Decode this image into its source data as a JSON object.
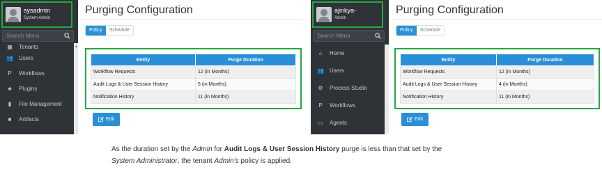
{
  "colors": {
    "accent": "#2a8fd6",
    "highlight_border": "#28a745",
    "sidebar_bg": "#2f3237"
  },
  "left": {
    "user": {
      "name": "sysadmin",
      "role": "System Admin"
    },
    "search_placeholder": "Search Menu",
    "menu": [
      {
        "label": "Tenants",
        "icon": "building-icon"
      },
      {
        "label": "Users",
        "icon": "users-icon"
      },
      {
        "label": "Workflows",
        "icon": "workflow-icon"
      },
      {
        "label": "Plugins",
        "icon": "plugin-icon"
      },
      {
        "label": "File Management",
        "icon": "file-icon"
      },
      {
        "label": "Artifacts",
        "icon": "artifact-icon"
      }
    ],
    "title": "Purging Configuration",
    "tabs": [
      "Policy",
      "Schedule"
    ],
    "table": {
      "headers": [
        "Entity",
        "Purge Duration"
      ],
      "rows": [
        [
          "Workflow Requests",
          "12 (in Months)"
        ],
        [
          "Audit Logs & User Session History",
          "5 (in Months)"
        ],
        [
          "Notification History",
          "11 (in Months)"
        ]
      ]
    },
    "edit_label": "Edit"
  },
  "right": {
    "user": {
      "name": "ajinkya-",
      "role": "Admin"
    },
    "search_placeholder": "Search Menu",
    "menu": [
      {
        "label": "Home",
        "icon": "home-icon"
      },
      {
        "label": "Users",
        "icon": "users-icon"
      },
      {
        "label": "Process Studio",
        "icon": "gears-icon"
      },
      {
        "label": "Workflows",
        "icon": "workflow-icon"
      },
      {
        "label": "Agents",
        "icon": "monitor-icon"
      }
    ],
    "title": "Purging Configuration",
    "tabs": [
      "Policy",
      "Schedule"
    ],
    "table": {
      "headers": [
        "Entity",
        "Purge Duration"
      ],
      "rows": [
        [
          "Workflow Requests",
          "12 (in Months)"
        ],
        [
          "Audit Logs & User Session History",
          "4 (in Months)"
        ],
        [
          "Notification History",
          "11 (in Months)"
        ]
      ]
    },
    "edit_label": "Edit"
  },
  "caption": {
    "p1": "As the duration set by the ",
    "admin": "Admin",
    "p2": " for ",
    "entity": "Audit Logs & User Session History",
    "p3": " purge is less than that set by the",
    "sysadmin": "System Administrator",
    "p4": ", the tenant ",
    "admin_poss": "Admin's",
    "p5": " policy is applied."
  }
}
